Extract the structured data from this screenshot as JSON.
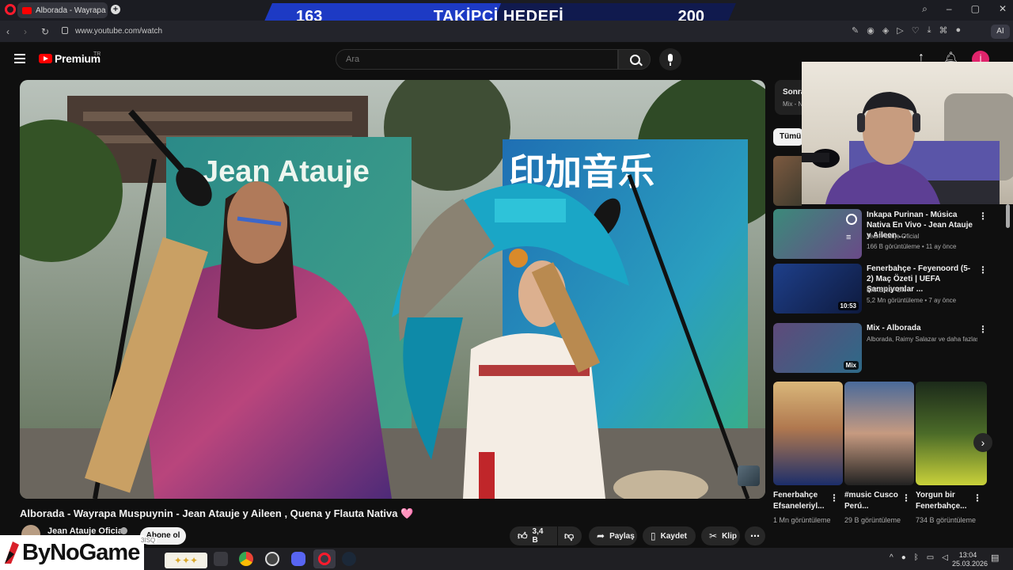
{
  "browser": {
    "tab_title": "Alborada - Wayrapa M",
    "tab_close": "×",
    "new_tab": "+",
    "url": "www.youtube.com/watch",
    "ai_label": "AI"
  },
  "follower_goal": {
    "current": "163",
    "label": "TAKİPÇİ HEDEFİ",
    "target": "200",
    "progress": 0.815
  },
  "header": {
    "brand": "Premium",
    "region": "TR",
    "search_placeholder": "Ara",
    "avatar_letter": "İ"
  },
  "video": {
    "title": "Alborada - Wayrapa Muspuynin - Jean Atauje y Aileen , Quena y Flauta Nativa 🩷",
    "channel": "Jean Atauje Oficial",
    "subscribe_label": "Abone ol",
    "likes": "3,4 B",
    "share_label": "Paylaş",
    "save_label": "Kaydet",
    "clip_label": "Klip",
    "banner_left": "Jean Atauje",
    "banner_right": "印加音乐"
  },
  "sidebar": {
    "up_next_title": "Sonra",
    "up_next_sub": "Mix - N",
    "chip_all": "Tümü",
    "items": [
      {
        "title": "Inkapa Purinan - Música Nativa En Vivo - Jean Atauje y Aileen ...",
        "channel": "Jean Atauje Oficial",
        "meta": "166 B görüntüleme • 11 ay önce"
      },
      {
        "title": "Fenerbahçe - Feyenoord (5-2) Maç Özeti | UEFA Şampiyonlar ...",
        "channel": "EXXENSPOR",
        "meta": "5,2 Mn görüntüleme • 7 ay önce",
        "duration": "10:53"
      },
      {
        "title": "Mix - Alborada",
        "channel": "Alborada, Raimy Salazar ve daha fazlası",
        "meta": "",
        "badge": "Mix"
      }
    ]
  },
  "shorts": [
    {
      "title": "Fenerbahçe Efsaneleriyl...",
      "views": "1 Mn görüntüleme"
    },
    {
      "title": "#music Cusco Perú...",
      "views": "29 B görüntüleme"
    },
    {
      "title": "Yorgun bir Fenerbahçe...",
      "views": "734 B görüntüleme"
    }
  ],
  "taskbar": {
    "time": "13:04",
    "date": "25.03.2026",
    "overlay_tag": "3ISQ"
  },
  "sponsor": {
    "name": "ByNoGame"
  },
  "colors": {
    "youtube_red": "#ff0000",
    "goal_fill": "#1d3ac4",
    "goal_band": "#101a4e",
    "opera_red": "#ff1b2d"
  }
}
